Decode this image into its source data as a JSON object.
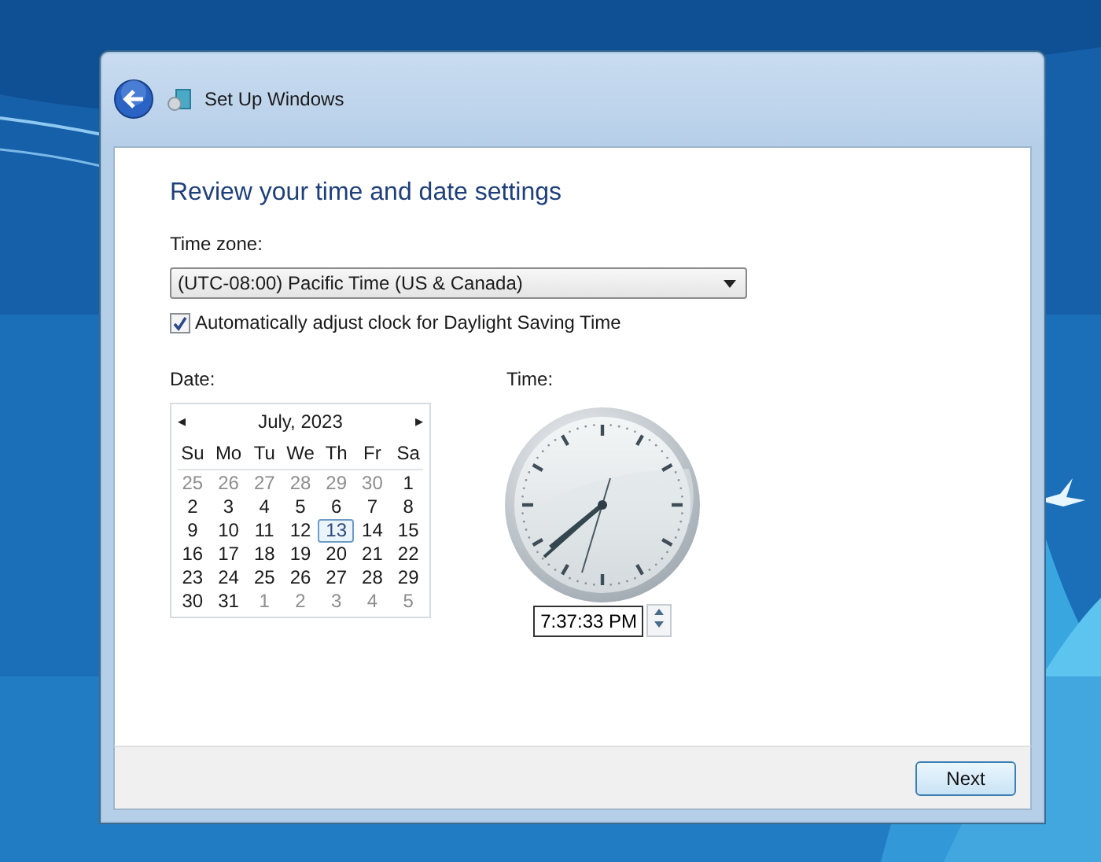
{
  "window": {
    "title": "Set Up Windows"
  },
  "heading": "Review your time and date settings",
  "time_zone": {
    "label": "Time zone:",
    "value": "(UTC-08:00) Pacific Time (US & Canada)"
  },
  "daylight": {
    "label": "Automatically adjust clock for Daylight Saving Time",
    "checked": true
  },
  "date": {
    "label": "Date:",
    "prev": "◂",
    "next": "▸",
    "month": "July, 2023",
    "weekdays": [
      "Su",
      "Mo",
      "Tu",
      "We",
      "Th",
      "Fr",
      "Sa"
    ],
    "days": [
      {
        "day": "25",
        "muted": true,
        "selected": false
      },
      {
        "day": "26",
        "muted": true,
        "selected": false
      },
      {
        "day": "27",
        "muted": true,
        "selected": false
      },
      {
        "day": "28",
        "muted": true,
        "selected": false
      },
      {
        "day": "29",
        "muted": true,
        "selected": false
      },
      {
        "day": "30",
        "muted": true,
        "selected": false
      },
      {
        "day": "1",
        "muted": false,
        "selected": false
      },
      {
        "day": "2",
        "muted": false,
        "selected": false
      },
      {
        "day": "3",
        "muted": false,
        "selected": false
      },
      {
        "day": "4",
        "muted": false,
        "selected": false
      },
      {
        "day": "5",
        "muted": false,
        "selected": false
      },
      {
        "day": "6",
        "muted": false,
        "selected": false
      },
      {
        "day": "7",
        "muted": false,
        "selected": false
      },
      {
        "day": "8",
        "muted": false,
        "selected": false
      },
      {
        "day": "9",
        "muted": false,
        "selected": false
      },
      {
        "day": "10",
        "muted": false,
        "selected": false
      },
      {
        "day": "11",
        "muted": false,
        "selected": false
      },
      {
        "day": "12",
        "muted": false,
        "selected": false
      },
      {
        "day": "13",
        "muted": false,
        "selected": true
      },
      {
        "day": "14",
        "muted": false,
        "selected": false
      },
      {
        "day": "15",
        "muted": false,
        "selected": false
      },
      {
        "day": "16",
        "muted": false,
        "selected": false
      },
      {
        "day": "17",
        "muted": false,
        "selected": false
      },
      {
        "day": "18",
        "muted": false,
        "selected": false
      },
      {
        "day": "19",
        "muted": false,
        "selected": false
      },
      {
        "day": "20",
        "muted": false,
        "selected": false
      },
      {
        "day": "21",
        "muted": false,
        "selected": false
      },
      {
        "day": "22",
        "muted": false,
        "selected": false
      },
      {
        "day": "23",
        "muted": false,
        "selected": false
      },
      {
        "day": "24",
        "muted": false,
        "selected": false
      },
      {
        "day": "25",
        "muted": false,
        "selected": false
      },
      {
        "day": "26",
        "muted": false,
        "selected": false
      },
      {
        "day": "27",
        "muted": false,
        "selected": false
      },
      {
        "day": "28",
        "muted": false,
        "selected": false
      },
      {
        "day": "29",
        "muted": false,
        "selected": false
      },
      {
        "day": "30",
        "muted": false,
        "selected": false
      },
      {
        "day": "31",
        "muted": false,
        "selected": false
      },
      {
        "day": "1",
        "muted": true,
        "selected": false
      },
      {
        "day": "2",
        "muted": true,
        "selected": false
      },
      {
        "day": "3",
        "muted": true,
        "selected": false
      },
      {
        "day": "4",
        "muted": true,
        "selected": false
      },
      {
        "day": "5",
        "muted": true,
        "selected": false
      }
    ]
  },
  "time": {
    "label": "Time:",
    "value": "7:37:33 PM"
  },
  "buttons": [
    "Next"
  ]
}
